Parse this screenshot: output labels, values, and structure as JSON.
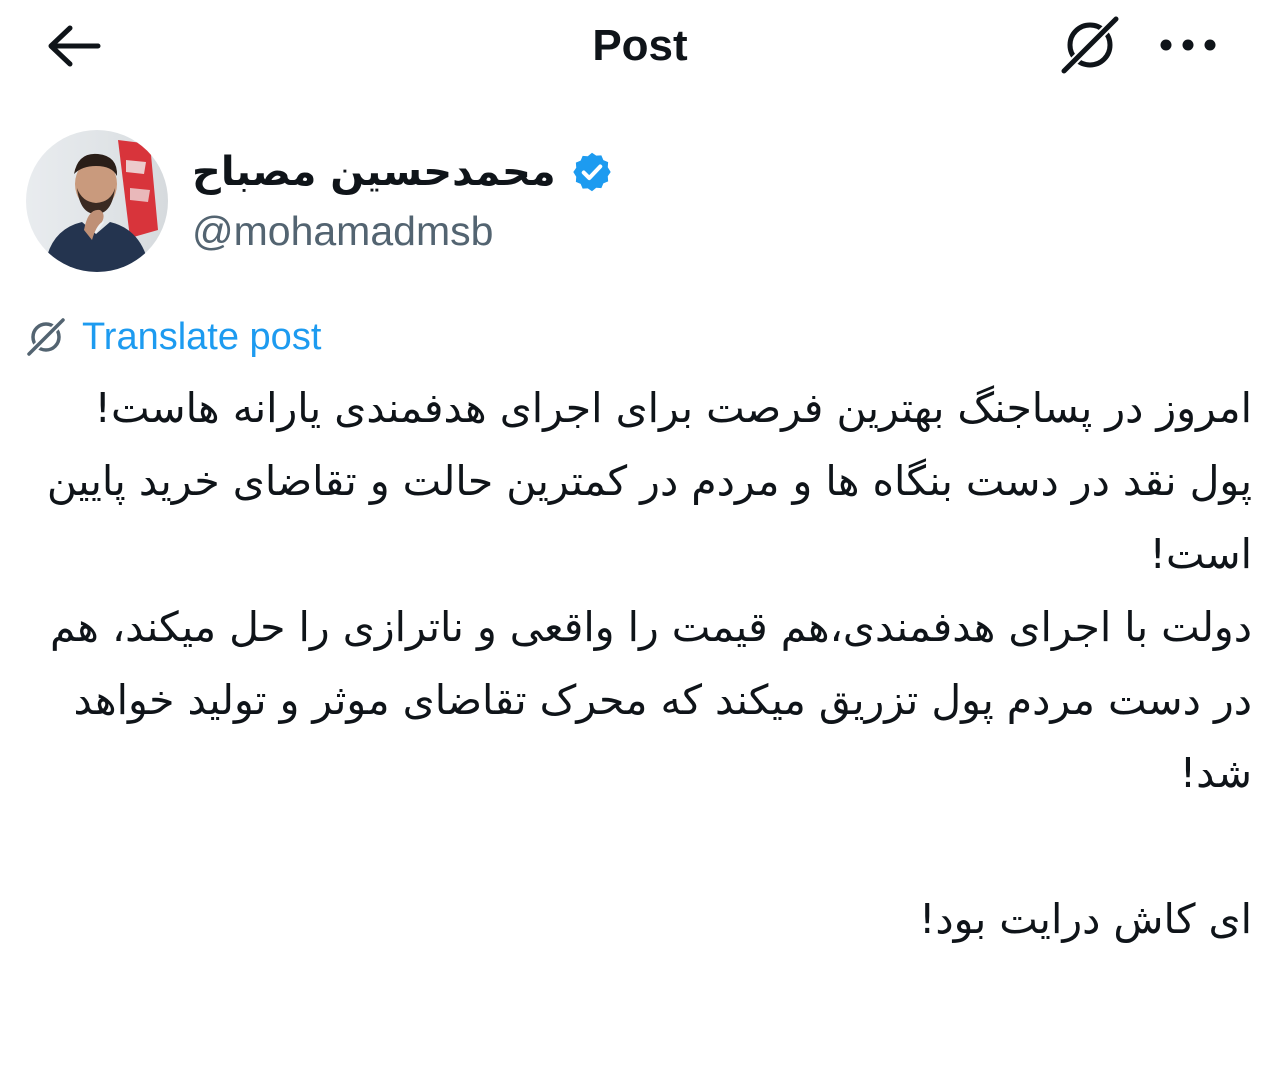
{
  "header": {
    "title": "Post",
    "back_icon": "arrow-left-icon",
    "grok_icon": "grok-icon",
    "more_icon": "more-horizontal-icon"
  },
  "author": {
    "display_name": "محمدحسین مصباح",
    "handle": "@mohamadmsb",
    "verified": true,
    "verified_color": "#1d9bf0"
  },
  "translate": {
    "label": "Translate post",
    "color": "#1d9bf0"
  },
  "post": {
    "paragraphs": [
      "امروز در پساجنگ بهترین فرصت برای اجرای هدفمندی یارانه هاست!",
      "پول نقد در دست بنگاه ها و مردم در کمترین حالت و تقاضای خرید پایین است!",
      "دولت با اجرای هدفمندی،هم قیمت را واقعی و ناترازی را حل میکند، هم در دست مردم پول تزریق میکند که محرک تقاضای موثر و تولید خواهد شد!",
      "",
      "ای کاش درایت بود!"
    ]
  }
}
